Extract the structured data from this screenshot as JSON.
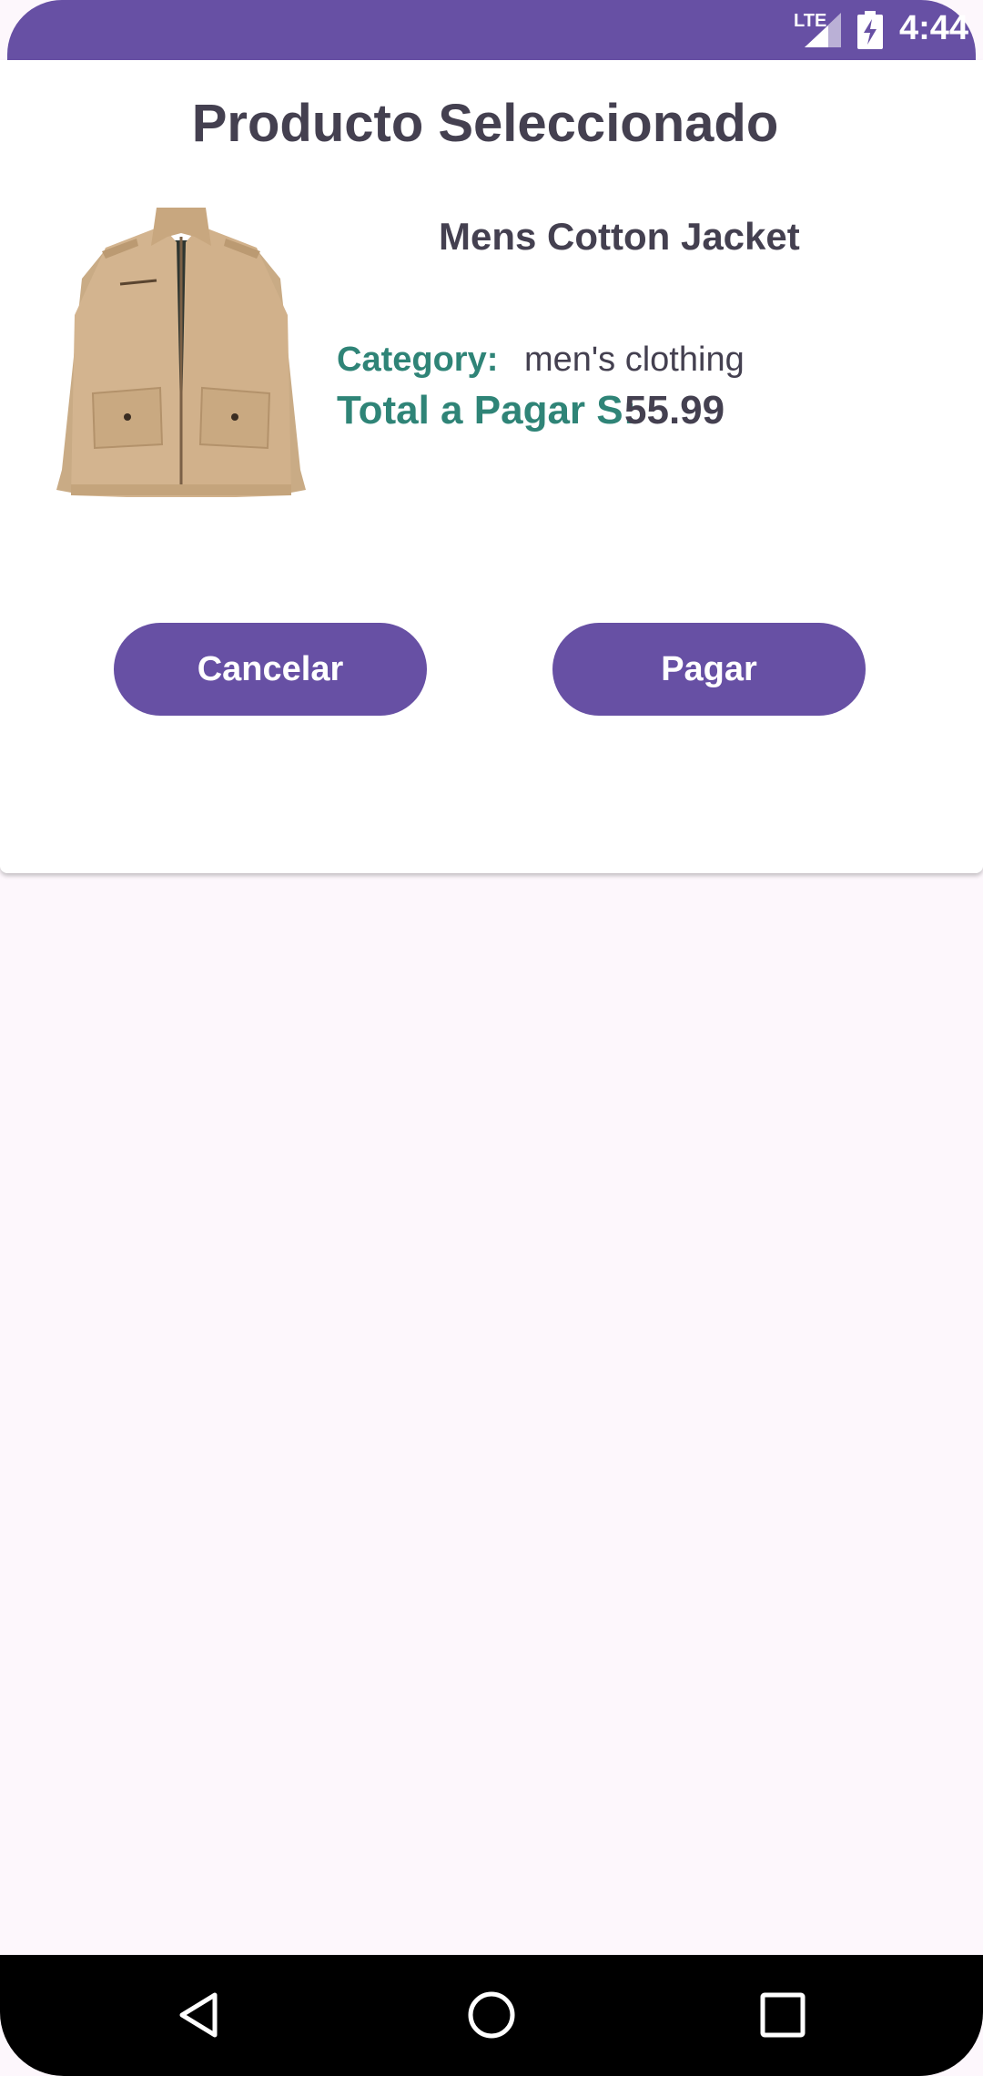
{
  "status_bar": {
    "network": "LTE",
    "time": "4:44",
    "icons": [
      "signal-icon",
      "battery-charging-icon"
    ],
    "color": "#6750a4"
  },
  "dialog": {
    "title": "Producto Seleccionado",
    "product": {
      "name": "Mens Cotton Jacket",
      "image": "cotton-jacket-image",
      "category_label": "Category:",
      "category_value": "men's clothing",
      "total_label": "Total a Pagar S:",
      "total_value": "55.99"
    },
    "buttons": {
      "cancel_label": "Cancelar",
      "pay_label": "Pagar"
    }
  },
  "nav_bar": {
    "icons": [
      "back-icon",
      "home-icon",
      "recents-icon"
    ]
  },
  "colors": {
    "primary": "#6750a4",
    "accent_label": "#2f8477",
    "text": "#444050",
    "background": "#fdf7fc"
  }
}
